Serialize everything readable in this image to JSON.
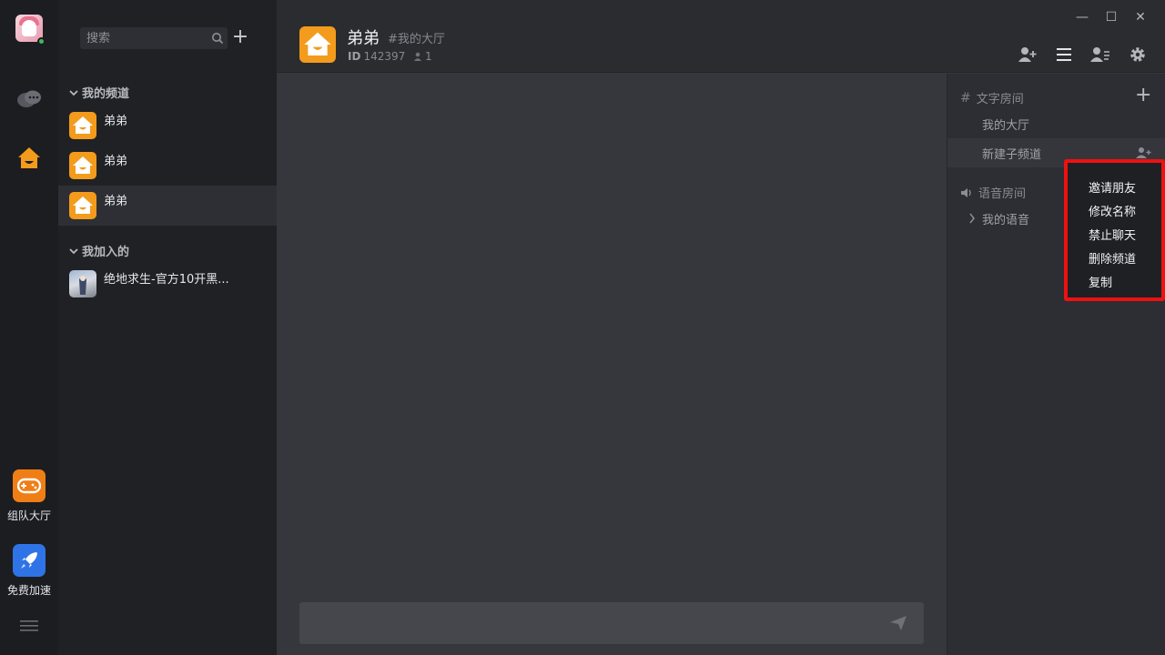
{
  "rail": {
    "apps": [
      {
        "label": "组队大厅",
        "color": "#f07e16"
      },
      {
        "label": "免费加速",
        "color": "#2f74e6"
      }
    ]
  },
  "sidebar": {
    "search_placeholder": "搜索",
    "add_label": "+",
    "my_channels_header": "我的频道",
    "my_channels": [
      {
        "name": "弟弟"
      },
      {
        "name": "弟弟"
      },
      {
        "name": "弟弟"
      }
    ],
    "joined_header": "我加入的",
    "joined": [
      {
        "name": "绝地求生-官方10开黑..."
      }
    ]
  },
  "header": {
    "title": "弟弟",
    "subtitle": "#我的大厅",
    "id_label": "ID",
    "id_value": "142397",
    "member_count": "1"
  },
  "window_controls": {
    "minimize": "—",
    "maximize": "☐",
    "close": "✕"
  },
  "rooms": {
    "text_section": "文字房间",
    "text_rooms": [
      "我的大厅",
      "新建子频道"
    ],
    "voice_section": "语音房间",
    "voice_rooms": [
      "我的语音"
    ]
  },
  "context_menu": {
    "items": [
      "邀请朋友",
      "修改名称",
      "禁止聊天",
      "删除频道",
      "复制"
    ]
  },
  "colors": {
    "accent_orange": "#f39b1c",
    "highlight_red": "#ee1111",
    "online_green": "#3fb960"
  }
}
